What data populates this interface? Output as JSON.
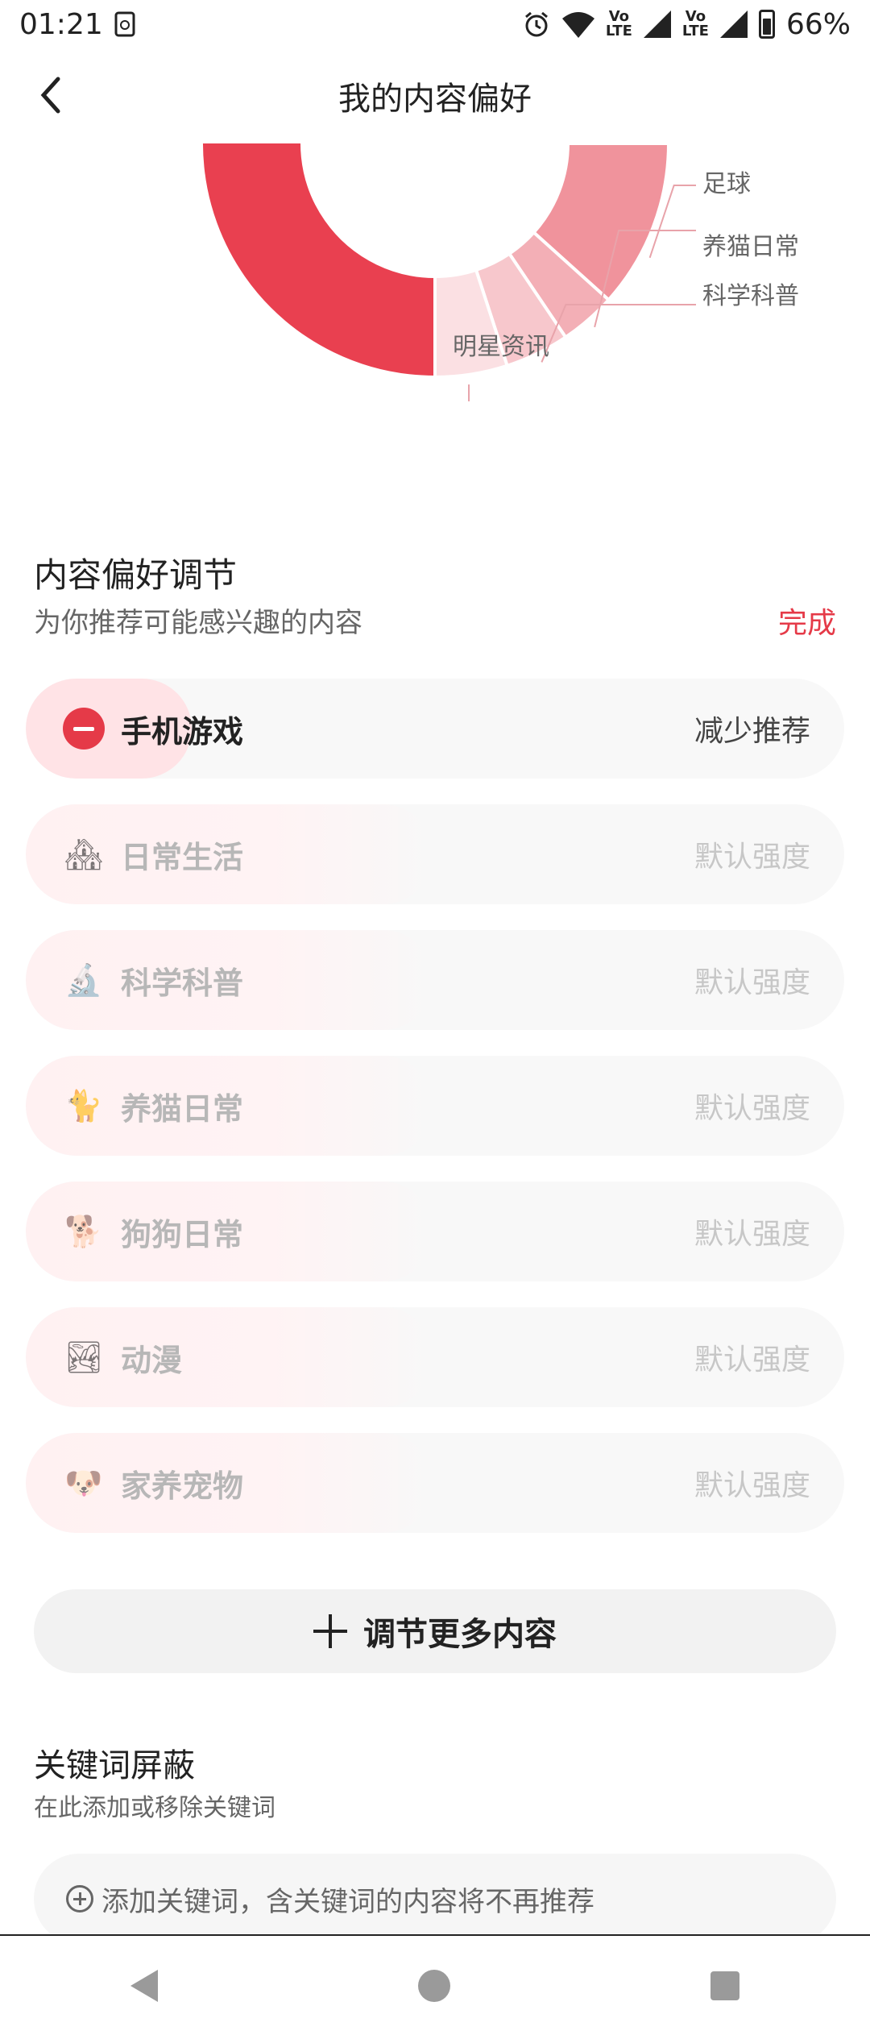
{
  "status_bar": {
    "time": "01:21",
    "battery": "66%",
    "lte_label": "LTE"
  },
  "header": {
    "title": "我的内容偏好"
  },
  "chart_data": {
    "type": "pie",
    "labels": [
      "足球",
      "养猫日常",
      "科学科普",
      "明星资讯"
    ],
    "slices": [
      {
        "name": "足球",
        "color": "#f0939c"
      },
      {
        "name": "养猫日常",
        "color": "#f3afb6"
      },
      {
        "name": "科学科普",
        "color": "#f7c7cc"
      },
      {
        "name": "明星资讯",
        "color": "#fbe0e3"
      },
      {
        "name": "",
        "color": "#e94050"
      }
    ]
  },
  "preferences": {
    "title": "内容偏好调节",
    "subtitle": "为你推荐可能感兴趣的内容",
    "done_label": "完成",
    "items": [
      {
        "label": "手机游戏",
        "value": "减少推荐",
        "icon": "minus-icon",
        "active": true
      },
      {
        "label": "日常生活",
        "value": "默认强度",
        "icon": "house-icon",
        "glyph": "🏘"
      },
      {
        "label": "科学科普",
        "value": "默认强度",
        "icon": "microscope-icon",
        "glyph": "🔬"
      },
      {
        "label": "养猫日常",
        "value": "默认强度",
        "icon": "cat-icon",
        "glyph": "🐈"
      },
      {
        "label": "狗狗日常",
        "value": "默认强度",
        "icon": "dog-icon",
        "glyph": "🐕"
      },
      {
        "label": "动漫",
        "value": "默认强度",
        "icon": "landscape-icon",
        "glyph": "🏞"
      },
      {
        "label": "家养宠物",
        "value": "默认强度",
        "icon": "puppy-icon",
        "glyph": "🐶"
      }
    ],
    "more_label": "调节更多内容"
  },
  "keywords": {
    "title": "关键词屏蔽",
    "subtitle": "在此添加或移除关键词",
    "placeholder": "添加关键词，含关键词的内容将不再推荐"
  },
  "colors": {
    "accent": "#e53a48"
  }
}
